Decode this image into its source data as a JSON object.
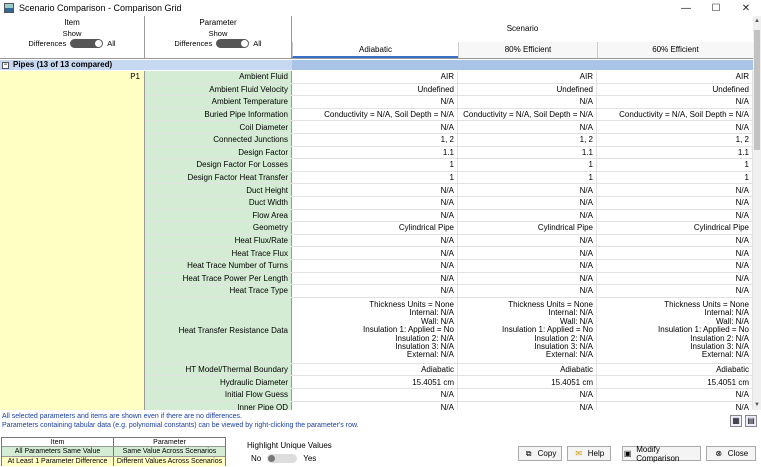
{
  "window": {
    "title": "Scenario Comparison - Comparison Grid",
    "minimize": "—",
    "maximize": "☐",
    "close": "✕"
  },
  "header": {
    "item_col": {
      "name": "Item",
      "show": "Show",
      "differences": "Differences",
      "all": "All"
    },
    "param_col": {
      "name": "Parameter",
      "show": "Show",
      "differences": "Differences",
      "all": "All"
    },
    "scenario_label": "Scenario",
    "scenarios": [
      "Adiabatic",
      "80% Efficient",
      "60% Efficient"
    ]
  },
  "section": {
    "title": "Pipes (13 of 13 compared)",
    "expander": "−"
  },
  "item": "P1",
  "rows": [
    {
      "param": "Ambient Fluid",
      "values": [
        "AIR",
        "AIR",
        "AIR"
      ]
    },
    {
      "param": "Ambient Fluid Velocity",
      "values": [
        "Undefined",
        "Undefined",
        "Undefined"
      ]
    },
    {
      "param": "Ambient Temperature",
      "values": [
        "N/A",
        "N/A",
        "N/A"
      ]
    },
    {
      "param": "Buried Pipe Information",
      "values": [
        "Conductivity = N/A, Soil Depth = N/A",
        "Conductivity = N/A, Soil Depth = N/A",
        "Conductivity = N/A, Soil Depth = N/A"
      ]
    },
    {
      "param": "Coil Diameter",
      "values": [
        "N/A",
        "N/A",
        "N/A"
      ]
    },
    {
      "param": "Connected Junctions",
      "values": [
        "1, 2",
        "1, 2",
        "1, 2"
      ]
    },
    {
      "param": "Design Factor",
      "values": [
        "1.1",
        "1.1",
        "1.1"
      ]
    },
    {
      "param": "Design Factor For Losses",
      "values": [
        "1",
        "1",
        "1"
      ]
    },
    {
      "param": "Design Factor Heat Transfer",
      "values": [
        "1",
        "1",
        "1"
      ]
    },
    {
      "param": "Duct Height",
      "values": [
        "N/A",
        "N/A",
        "N/A"
      ]
    },
    {
      "param": "Duct Width",
      "values": [
        "N/A",
        "N/A",
        "N/A"
      ]
    },
    {
      "param": "Flow Area",
      "values": [
        "N/A",
        "N/A",
        "N/A"
      ]
    },
    {
      "param": "Geometry",
      "values": [
        "Cylindrical Pipe",
        "Cylindrical Pipe",
        "Cylindrical Pipe"
      ]
    },
    {
      "param": "Heat Flux/Rate",
      "values": [
        "N/A",
        "N/A",
        "N/A"
      ]
    },
    {
      "param": "Heat Trace Flux",
      "values": [
        "N/A",
        "N/A",
        "N/A"
      ]
    },
    {
      "param": "Heat Trace Number of Turns",
      "values": [
        "N/A",
        "N/A",
        "N/A"
      ]
    },
    {
      "param": "Heat Trace Power Per Length",
      "values": [
        "N/A",
        "N/A",
        "N/A"
      ]
    },
    {
      "param": "Heat Trace Type",
      "values": [
        "N/A",
        "N/A",
        "N/A"
      ]
    },
    {
      "param": "Heat Transfer Resistance Data",
      "multi": true,
      "values": [
        [
          "Thickness Units = None",
          "Internal: N/A",
          "Wall: N/A",
          "Insulation 1: Applied = No",
          "Insulation 2: N/A",
          "Insulation 3: N/A",
          "External: N/A"
        ],
        [
          "Thickness Units = None",
          "Internal: N/A",
          "Wall: N/A",
          "Insulation 1: Applied = No",
          "Insulation 2: N/A",
          "Insulation 3: N/A",
          "External: N/A"
        ],
        [
          "Thickness Units = None",
          "Internal: N/A",
          "Wall: N/A",
          "Insulation 1: Applied = No",
          "Insulation 2: N/A",
          "Insulation 3: N/A",
          "External: N/A"
        ]
      ]
    },
    {
      "param": "HT Model/Thermal Boundary",
      "values": [
        "Adiabatic",
        "Adiabatic",
        "Adiabatic"
      ]
    },
    {
      "param": "Hydraulic Diameter",
      "values": [
        "15.4051 cm",
        "15.4051 cm",
        "15.4051 cm"
      ]
    },
    {
      "param": "Initial Flow Guess",
      "values": [
        "N/A",
        "N/A",
        "N/A"
      ]
    },
    {
      "param": "Inner Pipe OD",
      "values": [
        "N/A",
        "N/A",
        "N/A"
      ]
    }
  ],
  "notes": [
    "All selected parameters and items are shown even if there are no differences.",
    "Parameters containing tabular data (e.g. polynomial constants) can be viewed by right-clicking the parameter's row."
  ],
  "legend": {
    "head": [
      "Item",
      "Parameter"
    ],
    "rows": [
      [
        "All Parameters Same Value",
        "Same Value Across Scenarios"
      ],
      [
        "At Least 1 Parameter Difference",
        "Different Values Across Scenarios"
      ]
    ]
  },
  "highlight": {
    "label": "Highlight Unique Values",
    "no": "No",
    "yes": "Yes"
  },
  "buttons": {
    "copy": "Copy",
    "help": "Help",
    "modify": "Modify Comparison",
    "close": "Close"
  }
}
